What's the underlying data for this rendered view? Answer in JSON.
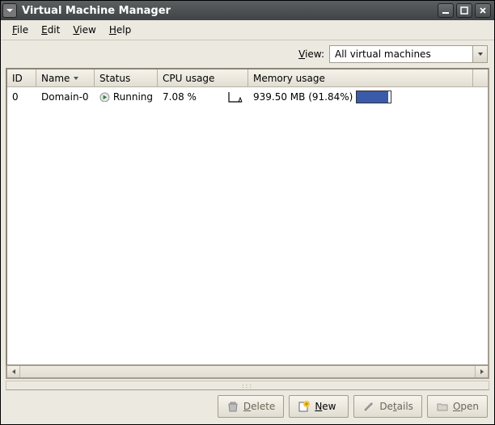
{
  "window": {
    "title": "Virtual Machine Manager"
  },
  "menubar": {
    "items": [
      {
        "label": "File",
        "accel": "F"
      },
      {
        "label": "Edit",
        "accel": "E"
      },
      {
        "label": "View",
        "accel": "V"
      },
      {
        "label": "Help",
        "accel": "H"
      }
    ]
  },
  "viewrow": {
    "label": "View:",
    "accel": "V",
    "selected": "All virtual machines"
  },
  "table": {
    "columns": {
      "id": "ID",
      "name": "Name",
      "status": "Status",
      "cpu": "CPU usage",
      "mem": "Memory usage"
    },
    "sort_column": "name",
    "rows": [
      {
        "id": "0",
        "name": "Domain-0",
        "status": "Running",
        "cpu_text": "7.08 %",
        "cpu_pct": 7.08,
        "mem_text": "939.50 MB (91.84%)",
        "mem_pct": 91.84
      }
    ]
  },
  "toolbar": {
    "delete": "Delete",
    "new": "New",
    "details": "Details",
    "open": "Open"
  }
}
